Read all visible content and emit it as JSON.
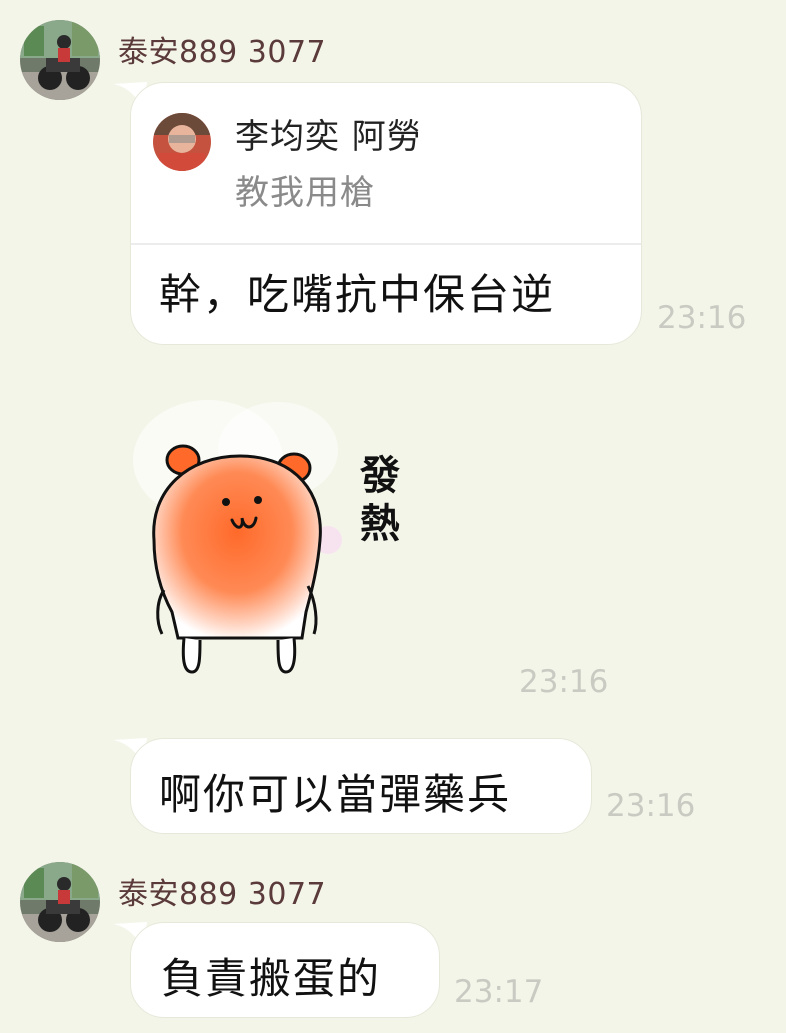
{
  "messages": [
    {
      "sender": "泰安889 3077",
      "quote": {
        "name": "李均奕 阿勞",
        "text": "教我用槍"
      },
      "text": "幹，吃嘴抗中保台逆",
      "time": "23:16"
    },
    {
      "sticker": {
        "icon": "hamster-blushing-sticker",
        "caption": "發熱"
      },
      "time": "23:16"
    },
    {
      "text": "啊你可以當彈藥兵",
      "time": "23:16"
    },
    {
      "sender": "泰安889 3077",
      "text": "負責搬蛋的",
      "time": "23:17"
    }
  ],
  "colors": {
    "background": "#f4f5e9",
    "bubble": "#ffffff",
    "sender_name": "#5a3a3a",
    "timestamp": "#c9cbc3"
  }
}
